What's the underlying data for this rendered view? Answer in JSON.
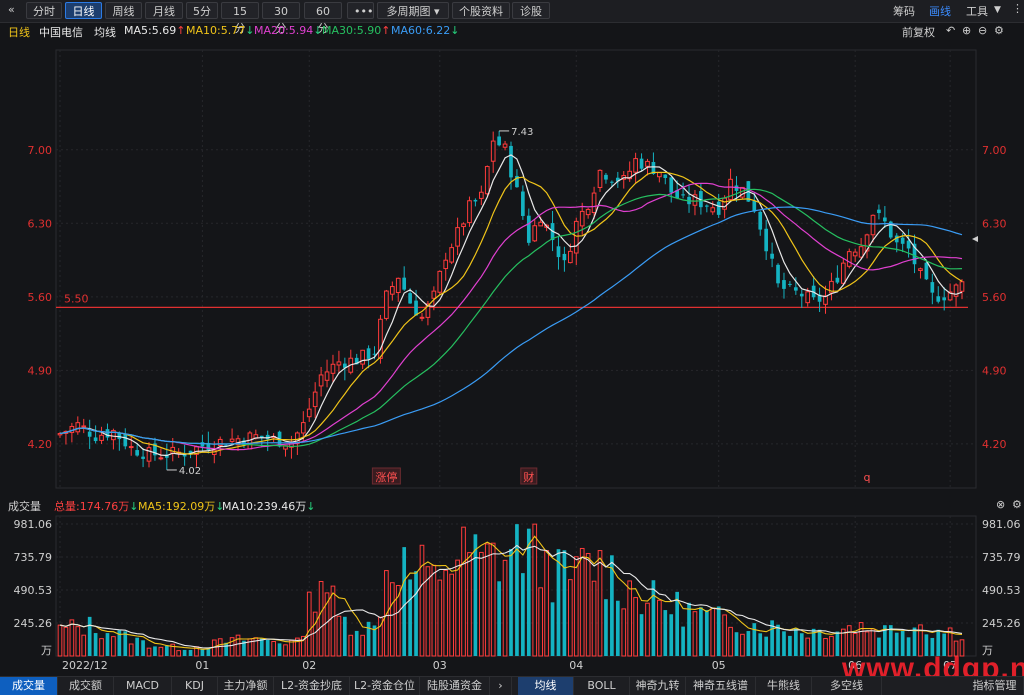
{
  "topbar": {
    "back_icon": "chevron-double-left-icon",
    "buttons": [
      "分时",
      "日线",
      "周线",
      "月线",
      "5分",
      "15分",
      "30分",
      "60分",
      "•••",
      "多周期图",
      "个股资料",
      "诊股"
    ],
    "active": "日线",
    "dropdown_icon": "triangle-down-icon",
    "right": [
      "筹码",
      "画线",
      "工具"
    ],
    "right_active": "画线"
  },
  "info": {
    "period": "日线",
    "stock": "中国电信",
    "ma_label": "均线",
    "ma": [
      {
        "text": "MA5:5.69",
        "arrow": "↑",
        "color": "#e8e8e8",
        "arrow_color": "#ff4040"
      },
      {
        "text": "MA10:5.77",
        "arrow": "↓",
        "color": "#f0c419",
        "arrow_color": "#26d07c"
      },
      {
        "text": "MA20:5.94",
        "arrow": "↓",
        "color": "#e040d0",
        "arrow_color": "#26d07c"
      },
      {
        "text": "MA30:5.90",
        "arrow": "↑",
        "color": "#26c060",
        "arrow_color": "#ff4040"
      },
      {
        "text": "MA60:6.22",
        "arrow": "↓",
        "color": "#3a9cf5",
        "arrow_color": "#26d07c"
      }
    ],
    "right_label": "前复权",
    "right_icons": [
      "undo-icon",
      "zoom-in-icon",
      "zoom-out-icon",
      "more-icon"
    ]
  },
  "volume_info": {
    "label": "成交量",
    "total": "总量:174.76万",
    "total_arrow": "↓",
    "ma5": "MA5:192.09万",
    "ma5_arrow": "↓",
    "ma10": "MA10:239.46万",
    "ma10_arrow": "↓",
    "close_icon": "close-circle-icon",
    "settings_icon": "settings-circle-icon"
  },
  "bottom_tabs": {
    "left": [
      "成交量",
      "成交额",
      "MACD",
      "KDJ",
      "主力净额",
      "L2-资金抄底",
      "L2-资金仓位",
      "陆股通资金"
    ],
    "left_active": "成交量",
    "more_icon": "chevron-right-icon",
    "right": [
      "均线",
      "BOLL",
      "神奇九转",
      "神奇五线谱",
      "牛熊线",
      "多空线"
    ],
    "right_active": "均线",
    "far_right": "指标管理"
  },
  "watermark": "www.ddgp.net",
  "chart_data": [
    {
      "type": "candlestick",
      "title": "",
      "y_ticks": [
        "7.00",
        "6.30",
        "5.60",
        "4.90",
        "4.20"
      ],
      "ylim": [
        3.78,
        7.95
      ],
      "x_ticks": [
        "2022/12",
        "01",
        "02",
        "03",
        "04",
        "05",
        "06",
        "07"
      ],
      "x_tick_index": [
        0,
        24,
        42,
        64,
        87,
        111,
        134,
        150
      ],
      "support_line": {
        "value": 5.5,
        "label": "5.50"
      },
      "high_annotation": "7.43",
      "low_annotation": "4.02",
      "markers": [
        {
          "text": "涨停",
          "index": 55
        },
        {
          "text": "财",
          "index": 79
        },
        {
          "text": "q",
          "index": 136
        }
      ],
      "anchors_close": [
        [
          0,
          4.3
        ],
        [
          3,
          4.38
        ],
        [
          6,
          4.28
        ],
        [
          9,
          4.32
        ],
        [
          12,
          4.16
        ],
        [
          15,
          4.1
        ],
        [
          18,
          4.1
        ],
        [
          21,
          4.12
        ],
        [
          24,
          4.18
        ],
        [
          27,
          4.22
        ],
        [
          30,
          4.25
        ],
        [
          33,
          4.27
        ],
        [
          36,
          4.24
        ],
        [
          39,
          4.22
        ],
        [
          41,
          4.38
        ],
        [
          44,
          4.85
        ],
        [
          47,
          4.98
        ],
        [
          50,
          5.0
        ],
        [
          53,
          5.08
        ],
        [
          55,
          5.6
        ],
        [
          57,
          5.8
        ],
        [
          59,
          5.55
        ],
        [
          61,
          5.4
        ],
        [
          63,
          5.6
        ],
        [
          65,
          6.0
        ],
        [
          67,
          6.2
        ],
        [
          69,
          6.45
        ],
        [
          71,
          6.55
        ],
        [
          73,
          7.1
        ],
        [
          75,
          7.0
        ],
        [
          77,
          6.6
        ],
        [
          79,
          6.15
        ],
        [
          81,
          6.38
        ],
        [
          83,
          6.15
        ],
        [
          85,
          5.9
        ],
        [
          87,
          6.3
        ],
        [
          89,
          6.5
        ],
        [
          91,
          6.8
        ],
        [
          93,
          6.75
        ],
        [
          95,
          6.7
        ],
        [
          97,
          6.9
        ],
        [
          99,
          6.85
        ],
        [
          101,
          6.8
        ],
        [
          103,
          6.6
        ],
        [
          105,
          6.5
        ],
        [
          107,
          6.52
        ],
        [
          109,
          6.48
        ],
        [
          111,
          6.45
        ],
        [
          113,
          6.7
        ],
        [
          115,
          6.62
        ],
        [
          117,
          6.45
        ],
        [
          119,
          6.1
        ],
        [
          121,
          5.7
        ],
        [
          123,
          5.65
        ],
        [
          125,
          5.62
        ],
        [
          127,
          5.55
        ],
        [
          129,
          5.6
        ],
        [
          131,
          5.8
        ],
        [
          133,
          6.05
        ],
        [
          135,
          6.1
        ],
        [
          137,
          6.4
        ],
        [
          139,
          6.3
        ],
        [
          141,
          6.1
        ],
        [
          143,
          6.05
        ],
        [
          145,
          5.8
        ],
        [
          147,
          5.6
        ],
        [
          149,
          5.62
        ],
        [
          151,
          5.68
        ],
        [
          152,
          5.72
        ]
      ],
      "series": [
        {
          "name": "MA5",
          "value": 5.69,
          "color": "#e8e8e8",
          "period": 5
        },
        {
          "name": "MA10",
          "value": 5.77,
          "color": "#f0c419",
          "period": 10
        },
        {
          "name": "MA20",
          "value": 5.94,
          "color": "#e040d0",
          "period": 20
        },
        {
          "name": "MA30",
          "value": 5.9,
          "color": "#26c060",
          "period": 30
        },
        {
          "name": "MA60",
          "value": 6.22,
          "color": "#3a9cf5",
          "period": 60
        }
      ]
    },
    {
      "type": "bar",
      "title": "成交量",
      "y_ticks": [
        "981.06",
        "735.79",
        "490.53",
        "245.26",
        "万"
      ],
      "ylim": [
        0,
        981.06
      ],
      "anchors_volume": [
        [
          0,
          200
        ],
        [
          5,
          230
        ],
        [
          10,
          160
        ],
        [
          15,
          90
        ],
        [
          20,
          60
        ],
        [
          24,
          75
        ],
        [
          28,
          110
        ],
        [
          32,
          130
        ],
        [
          36,
          120
        ],
        [
          40,
          100
        ],
        [
          42,
          380
        ],
        [
          44,
          650
        ],
        [
          47,
          280
        ],
        [
          50,
          240
        ],
        [
          53,
          210
        ],
        [
          55,
          640
        ],
        [
          57,
          760
        ],
        [
          59,
          610
        ],
        [
          61,
          640
        ],
        [
          63,
          560
        ],
        [
          65,
          740
        ],
        [
          67,
          720
        ],
        [
          69,
          800
        ],
        [
          71,
          690
        ],
        [
          73,
          760
        ],
        [
          75,
          740
        ],
        [
          77,
          900
        ],
        [
          79,
          840
        ],
        [
          81,
          720
        ],
        [
          83,
          660
        ],
        [
          85,
          600
        ],
        [
          87,
          620
        ],
        [
          89,
          700
        ],
        [
          91,
          680
        ],
        [
          93,
          640
        ],
        [
          95,
          540
        ],
        [
          97,
          480
        ],
        [
          99,
          440
        ],
        [
          101,
          400
        ],
        [
          103,
          380
        ],
        [
          105,
          360
        ],
        [
          107,
          330
        ],
        [
          109,
          300
        ],
        [
          111,
          280
        ],
        [
          113,
          270
        ],
        [
          115,
          260
        ],
        [
          117,
          240
        ],
        [
          119,
          220
        ],
        [
          121,
          230
        ],
        [
          123,
          210
        ],
        [
          125,
          200
        ],
        [
          127,
          190
        ],
        [
          129,
          200
        ],
        [
          131,
          210
        ],
        [
          133,
          220
        ],
        [
          135,
          230
        ],
        [
          137,
          210
        ],
        [
          139,
          200
        ],
        [
          141,
          230
        ],
        [
          143,
          220
        ],
        [
          145,
          250
        ],
        [
          147,
          200
        ],
        [
          149,
          190
        ],
        [
          151,
          180
        ],
        [
          152,
          175
        ]
      ]
    }
  ]
}
